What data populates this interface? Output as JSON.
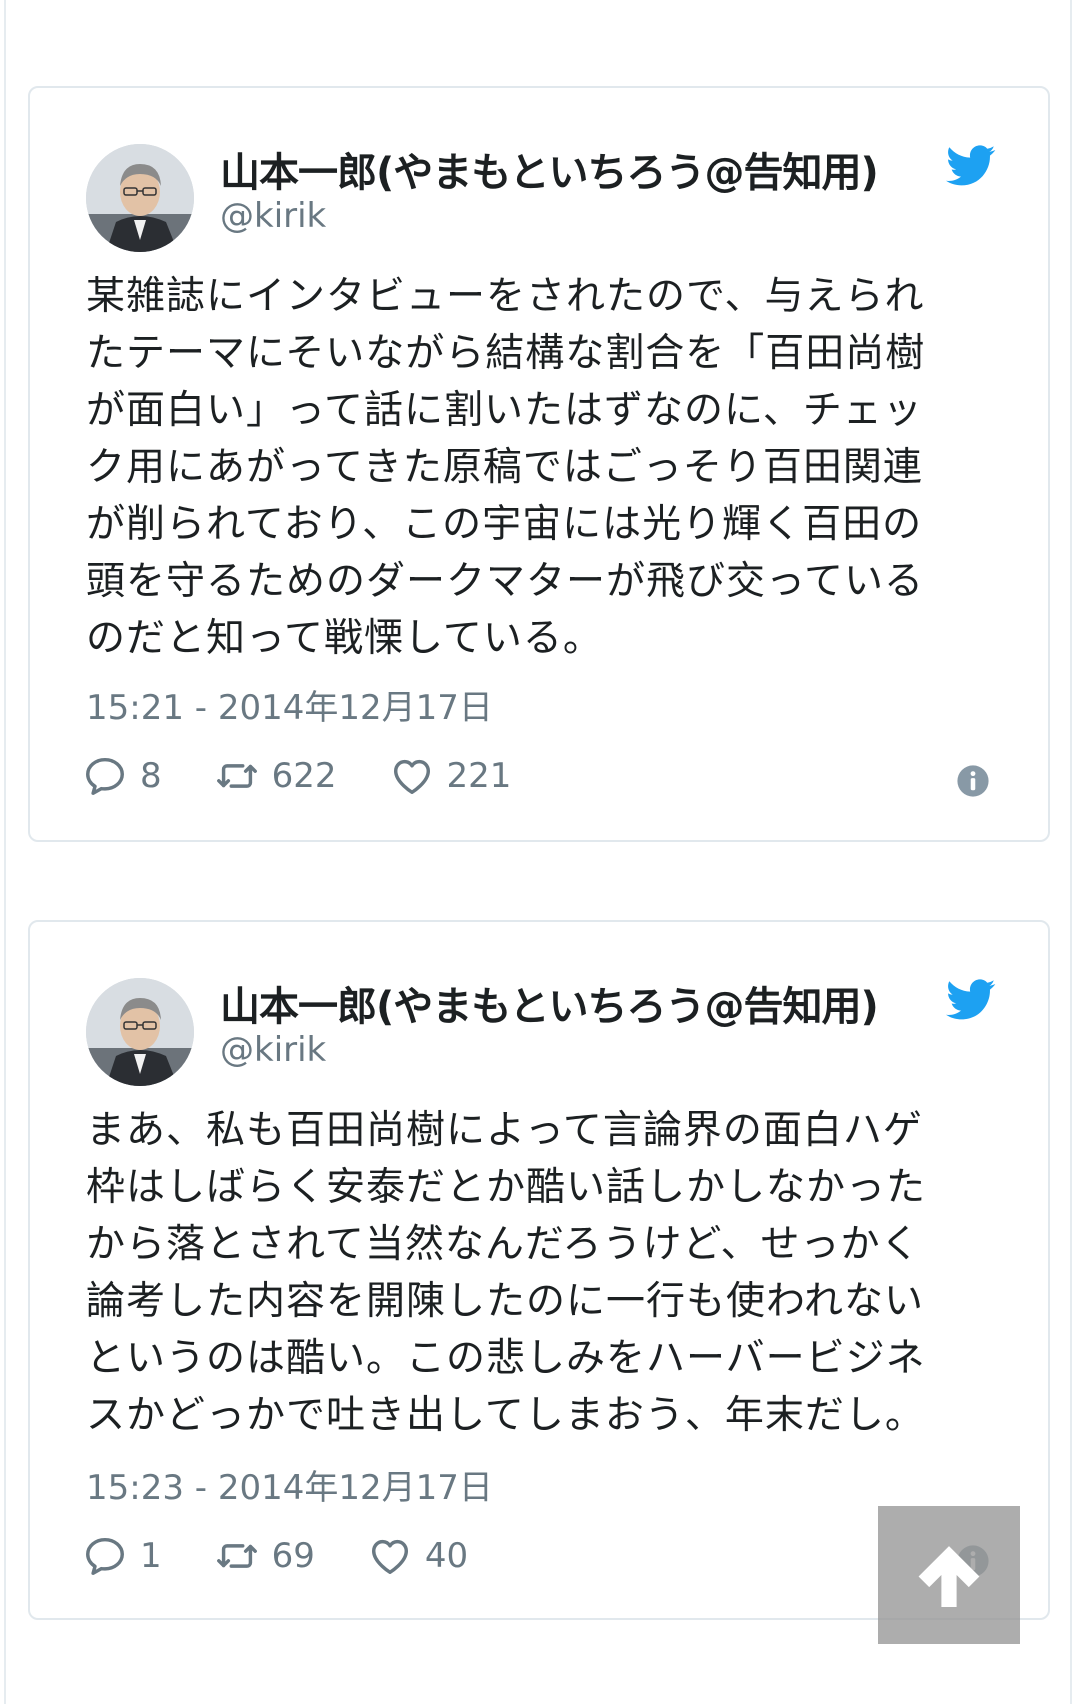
{
  "tweets": [
    {
      "author": {
        "display_name": "山本一郎(やまもといちろう@告知用)",
        "handle": "@kirik"
      },
      "text": "某雑誌にインタビューをされたので、与えられ\nたテーマにそいながら結構な割合を「百田尚樹\nが面白い」って話に割いたはずなのに、チェッ\nク用にあがってきた原稿ではごっそり百田関連\nが削られており、この宇宙には光り輝く百田の\n頭を守るためのダークマターが飛び交っている\nのだと知って戦慄している。",
      "timestamp": "15:21 - 2014年12月17日",
      "replies": "8",
      "retweets": "622",
      "likes": "221"
    },
    {
      "author": {
        "display_name": "山本一郎(やまもといちろう@告知用)",
        "handle": "@kirik"
      },
      "text": "まあ、私も百田尚樹によって言論界の面白ハゲ\n枠はしばらく安泰だとか酷い話しかしなかった\nから落とされて当然なんだろうけど、せっかく\n論考した内容を開陳したのに一行も使われない\nというのは酷い。この悲しみをハーバービジネ\nスかどっかで吐き出してしまおう、年末だし。",
      "timestamp": "15:23 - 2014年12月17日",
      "replies": "1",
      "retweets": "69",
      "likes": "40"
    }
  ],
  "icons": {
    "brand": "twitter-bird-icon",
    "reply": "speech-bubble-icon",
    "retweet": "retweet-icon",
    "like": "heart-icon",
    "info": "info-icon",
    "scroll_top": "arrow-up-icon"
  },
  "colors": {
    "brand": "#1da1f2",
    "text": "#1c2022",
    "muted": "#697882",
    "border": "#e1e8ed"
  }
}
